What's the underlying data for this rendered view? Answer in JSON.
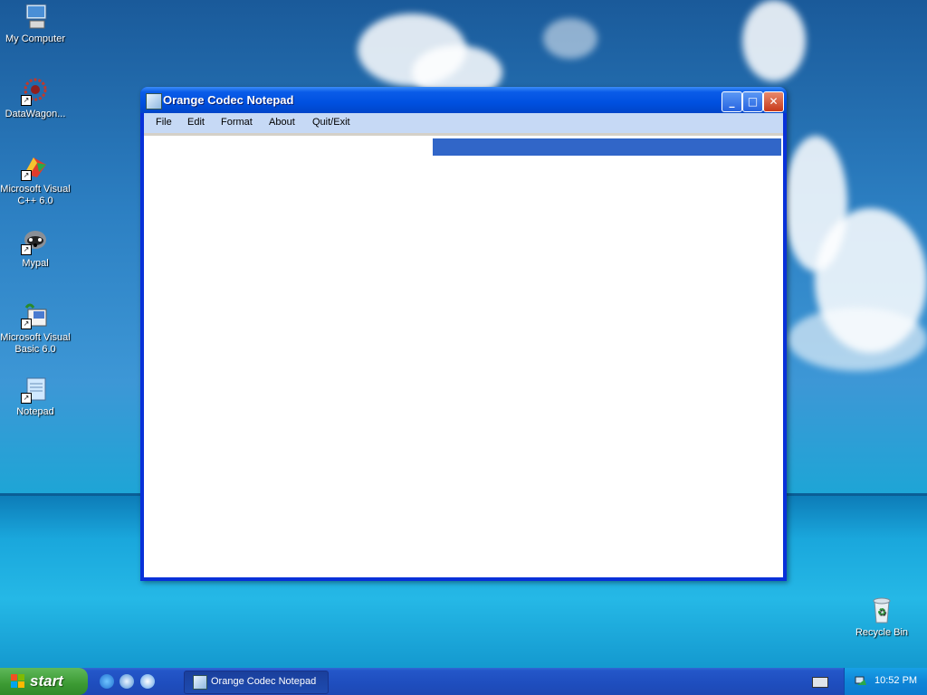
{
  "desktop": {
    "icons": [
      {
        "label": "My Computer",
        "icon": "computer-icon"
      },
      {
        "label": "DataWagon...",
        "icon": "datawagon-icon"
      },
      {
        "label": "Microsoft Visual C++ 6.0",
        "icon": "visual-cpp-icon"
      },
      {
        "label": "Mypal",
        "icon": "mypal-icon"
      },
      {
        "label": "Microsoft Visual Basic 6.0",
        "icon": "visual-basic-icon"
      },
      {
        "label": "Notepad",
        "icon": "notepad-icon"
      }
    ],
    "recycle_bin": {
      "label": "Recycle Bin",
      "icon": "recycle-bin-icon"
    }
  },
  "window": {
    "title": "Orange Codec Notepad",
    "menu": [
      "File",
      "Edit",
      "Format",
      "About",
      "Quit/Exit"
    ],
    "buttons": {
      "minimize": "_",
      "maximize": "□",
      "close": "✕"
    }
  },
  "taskbar": {
    "start_label": "start",
    "task_label": "Orange Codec Notepad",
    "clock": "10:52 PM"
  },
  "colors": {
    "titlebar": "#0050e0",
    "menubar": "#c6d9f5",
    "selection": "#3166c8",
    "taskbar": "#1f4fc0",
    "start_button": "#3c9a33"
  }
}
